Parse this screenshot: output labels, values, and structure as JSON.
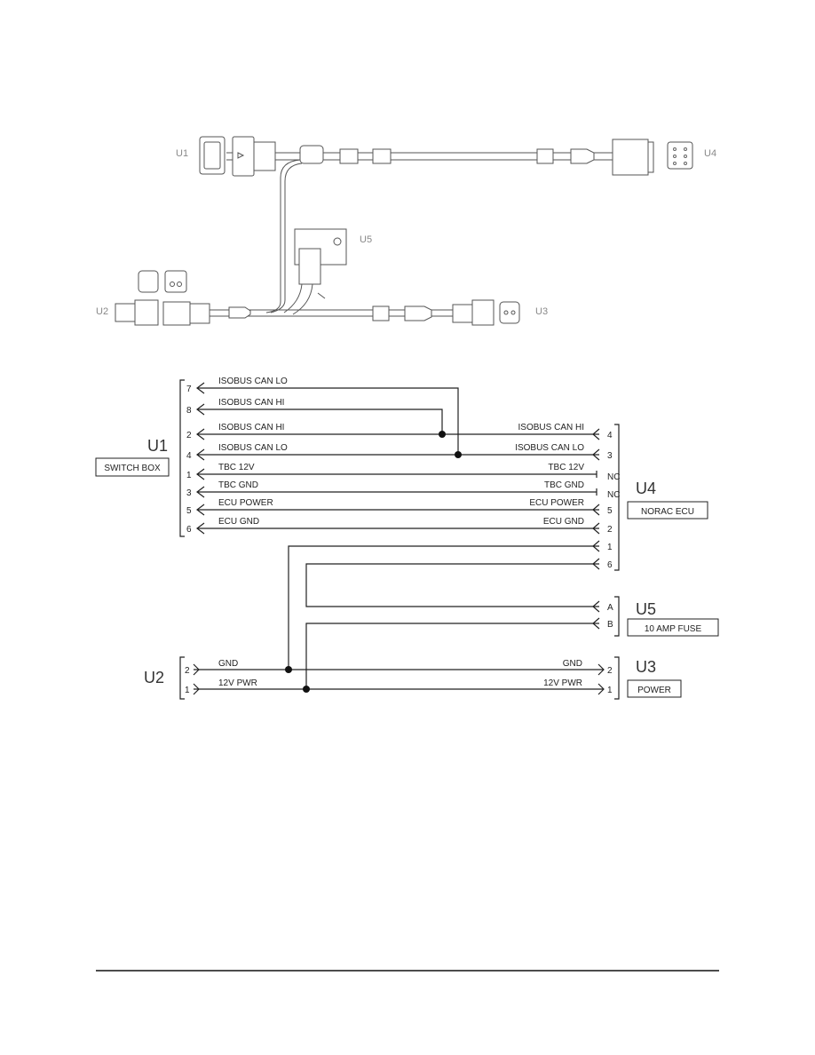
{
  "harness": {
    "labels": [
      "U1",
      "U4",
      "U5",
      "U2",
      "U3"
    ]
  },
  "schematic": {
    "u1": {
      "id": "U1",
      "name": "SWITCH BOX",
      "pins": [
        {
          "pin": "7",
          "signal": "ISOBUS CAN LO"
        },
        {
          "pin": "8",
          "signal": "ISOBUS CAN HI"
        },
        {
          "pin": "2",
          "signal": "ISOBUS CAN HI"
        },
        {
          "pin": "4",
          "signal": "ISOBUS CAN LO"
        },
        {
          "pin": "1",
          "signal": "TBC 12V"
        },
        {
          "pin": "3",
          "signal": "TBC GND"
        },
        {
          "pin": "5",
          "signal": "ECU POWER"
        },
        {
          "pin": "6",
          "signal": "ECU GND"
        }
      ]
    },
    "u4": {
      "id": "U4",
      "name": "NORAC ECU",
      "pins": [
        {
          "pin": "4",
          "signal": "ISOBUS CAN HI"
        },
        {
          "pin": "3",
          "signal": "ISOBUS CAN LO"
        },
        {
          "pin": "NC",
          "signal": "TBC 12V"
        },
        {
          "pin": "NC",
          "signal": "TBC GND"
        },
        {
          "pin": "5",
          "signal": "ECU POWER"
        },
        {
          "pin": "2",
          "signal": "ECU GND"
        },
        {
          "pin": "1",
          "signal": ""
        },
        {
          "pin": "6",
          "signal": ""
        }
      ]
    },
    "u5": {
      "id": "U5",
      "name": "10 AMP FUSE",
      "pins": [
        "A",
        "B"
      ]
    },
    "u2": {
      "id": "U2",
      "pins": [
        {
          "pin": "2",
          "signal": "GND"
        },
        {
          "pin": "1",
          "signal": "12V PWR"
        }
      ]
    },
    "u3": {
      "id": "U3",
      "name": "POWER",
      "pins": [
        {
          "pin": "2",
          "signal": "GND"
        },
        {
          "pin": "1",
          "signal": "12V PWR"
        }
      ]
    }
  }
}
